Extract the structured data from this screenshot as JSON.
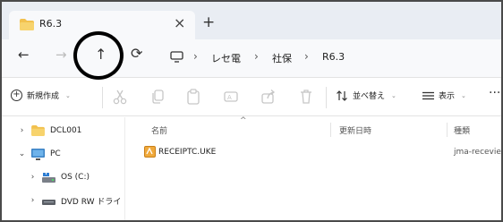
{
  "tab": {
    "title": "R6.3",
    "close": "×",
    "new": "+"
  },
  "nav": {
    "back": "←",
    "forward": "→",
    "up": "↑",
    "refresh": "⟳"
  },
  "address": {
    "segments": [
      "レセ電",
      "社保",
      "R6.3"
    ],
    "separator": "›"
  },
  "commands": {
    "new_label": "新規作成",
    "sort_label": "並べ替え",
    "view_label": "表示",
    "more": "···",
    "icons": [
      "cut-icon",
      "copy-icon",
      "paste-icon",
      "rename-icon",
      "share-icon",
      "delete-icon"
    ]
  },
  "tree": [
    {
      "label": "DCL001",
      "chevron": "›",
      "icon": "folder-icon"
    },
    {
      "label": "PC",
      "chevron": "⌄",
      "icon": "pc-icon"
    },
    {
      "label": "OS (C:)",
      "chevron": "›",
      "icon": "drive-icon"
    },
    {
      "label": "DVD RW ドライ",
      "chevron": "›",
      "icon": "dvd-drive-icon"
    }
  ],
  "columns": {
    "name": "名前",
    "modified": "更新日時",
    "type": "種類"
  },
  "files": [
    {
      "name": "RECEIPTC.UKE",
      "type": "jma-recevie"
    }
  ],
  "colors": {
    "folder": "#f2c14e",
    "pc_blue": "#3b82c4",
    "tab_bg": "#e9edf3",
    "accent_circle": "#000000"
  }
}
